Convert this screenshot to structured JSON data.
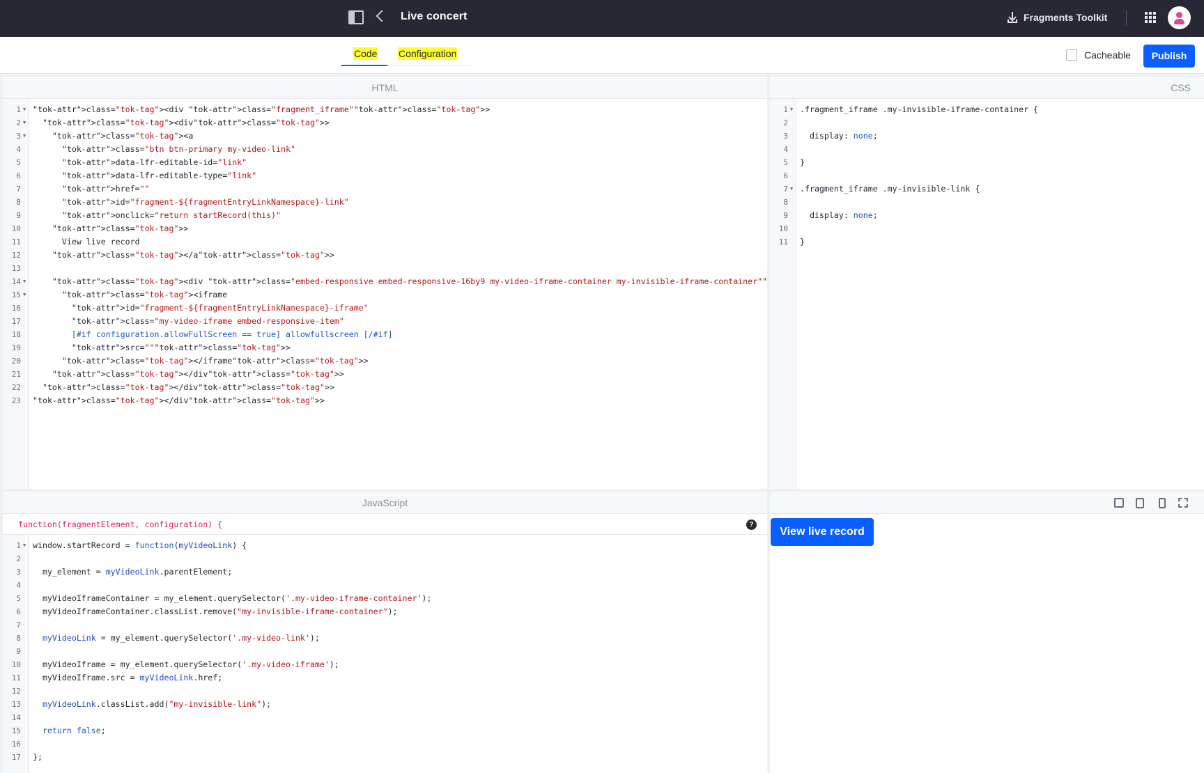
{
  "header": {
    "title": "Live concert",
    "toolkit_label": "Fragments Toolkit"
  },
  "tabs": {
    "code": "Code",
    "configuration": "Configuration"
  },
  "actions": {
    "cacheable_label": "Cacheable",
    "publish_label": "Publish"
  },
  "panes": {
    "html": "HTML",
    "css": "CSS",
    "javascript": "JavaScript"
  },
  "js_signature": "function(fragmentElement, configuration) {",
  "help_glyph": "?",
  "preview": {
    "button_label": "View live record"
  },
  "html_code": [
    "<div class=\"fragment_iframe\">",
    "  <div>",
    "    <a",
    "      class=\"btn btn-primary my-video-link\"",
    "      data-lfr-editable-id=\"link\"",
    "      data-lfr-editable-type=\"link\"",
    "      href=\"\"",
    "      id=\"fragment-${fragmentEntryLinkNamespace}-link\"",
    "      onclick=\"return startRecord(this)\"",
    "    >",
    "      View live record",
    "    </a>",
    "",
    "    <div class=\"embed-responsive embed-responsive-16by9 my-video-iframe-container my-invisible-iframe-container\">",
    "      <iframe",
    "        id=\"fragment-${fragmentEntryLinkNamespace}-iframe\"",
    "        class=\"my-video-iframe embed-responsive-item\"",
    "        [#if configuration.allowFullScreen == true] allowfullscreen [/#if]",
    "        src=\"\">",
    "      </iframe>",
    "    </div>",
    "  </div>",
    "</div>"
  ],
  "css_code": [
    ".fragment_iframe .my-invisible-iframe-container {",
    "",
    "  display: none;",
    "",
    "}",
    "",
    ".fragment_iframe .my-invisible-link {",
    "",
    "  display: none;",
    "",
    "}"
  ],
  "js_code": [
    "window.startRecord = function(myVideoLink) {",
    "",
    "  my_element = myVideoLink.parentElement;",
    "",
    "  myVideoIframeContainer = my_element.querySelector('.my-video-iframe-container');",
    "  myVideoIframeContainer.classList.remove(\"my-invisible-iframe-container\");",
    "",
    "  myVideoLink = my_element.querySelector('.my-video-link');",
    "",
    "  myVideoIframe = my_element.querySelector('.my-video-iframe');",
    "  myVideoIframe.src = myVideoLink.href;",
    "",
    "  myVideoLink.classList.add(\"my-invisible-link\");",
    "",
    "  return false;",
    "",
    "};"
  ],
  "folds": {
    "html": [
      1,
      2,
      3,
      14,
      15
    ],
    "css": [
      1,
      7
    ],
    "js": [
      1
    ]
  }
}
